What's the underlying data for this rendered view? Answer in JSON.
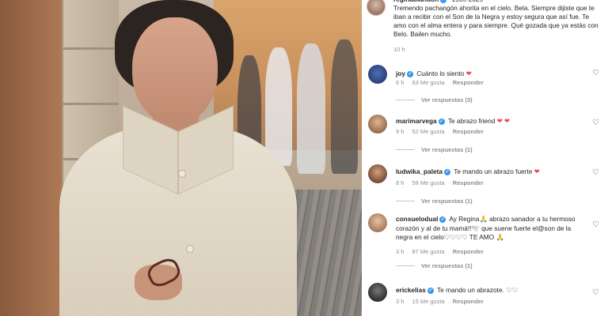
{
  "caption": {
    "username": "reginablandon",
    "years": "1935-2025",
    "text": "Tremendo pachangón ahorita en el cielo. Bela. Siempre dijiste que te iban a recibir con el Son de la Negra y estoy segura que así fue. Te amo con el alma entera y para siempre. Qué gozada que ya estás con Belo. Bailen mucho.",
    "time": "10 h"
  },
  "comments": [
    {
      "username": "joy",
      "text": "Cuánto lo siento",
      "emoji": "❤",
      "time": "6 h",
      "likes": "63 Me gusta",
      "reply_label": "Responder",
      "replies_label": "Ver respuestas (3)",
      "avatar_color": "#2c4a8a"
    },
    {
      "username": "marimarvega",
      "text": "Te abrazo friend",
      "emoji": "❤ ❤",
      "time": "9 h",
      "likes": "52 Me gusta",
      "reply_label": "Responder",
      "replies_label": "Ver respuestas (1)",
      "avatar_color": "#8a5a3a"
    },
    {
      "username": "ludwika_paleta",
      "text": "Te mando un abrazo fuerte",
      "emoji": "❤",
      "time": "8 h",
      "likes": "58 Me gusta",
      "reply_label": "Responder",
      "replies_label": "Ver respuestas (1)",
      "avatar_color": "#6a4a3a"
    },
    {
      "username": "consuelodual",
      "text": "Ay Regina🙏 abrazo sanador a tu hermoso corazón y al de tu mamá!!🕊️ que suene fuerte el@son de la negra en el cielo♡♡♡♡ TE AMO 🙏",
      "emoji": "",
      "time": "3 h",
      "likes": "87 Me gusta",
      "reply_label": "Responder",
      "replies_label": "Ver respuestas (1)",
      "avatar_color": "#a07a5a"
    },
    {
      "username": "erickelias",
      "text": "Te mando un abrazote. ♡♡",
      "emoji": "",
      "time": "3 h",
      "likes": "15 Me gusta",
      "reply_label": "Responder",
      "replies_label": "",
      "avatar_color": "#333333"
    }
  ],
  "icons": {
    "like": "heart-outline-icon",
    "verified": "verified-badge-icon"
  },
  "colors": {
    "verified": "#3897f0",
    "heart": "#ed4956",
    "muted": "#8e8e8e"
  }
}
